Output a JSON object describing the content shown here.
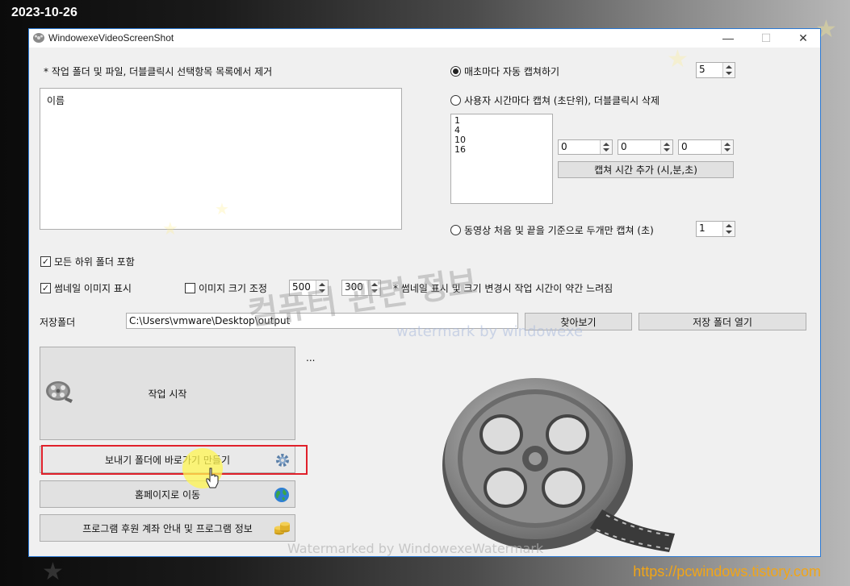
{
  "page": {
    "date": "2023-10-26",
    "site": "https://pcwindows.tistory.com"
  },
  "window": {
    "title": "WindowexeVideoScreenShot",
    "controls": [
      "—",
      "☐",
      "✕"
    ]
  },
  "left": {
    "folder_hint": "* 작업 폴더 및 파일, 더블클릭시 선택항목 목록에서 제거",
    "list_header": "이름",
    "include_subfolders": "모든 하위 폴더 포함",
    "show_thumbs": "썸네일 이미지 표시",
    "resize_images": "이미지 크기 조정",
    "width": "500",
    "height": "300",
    "thumb_note": "* 썸네일 표시 및 크기 변경시 작업 시간이 약간 느려짐",
    "save_label": "저장폴더",
    "save_path": "C:\\Users\\vmware\\Desktop\\output",
    "browse": "찾아보기",
    "open_folder": "저장 폴더 열기",
    "start": "작업 시작",
    "status_dots": "...",
    "sendto": "보내기 폴더에 바로가기 만들기",
    "homepage": "홈페이지로 이동",
    "about": "프로그램 후원 계좌 안내 및 프로그램 정보"
  },
  "right": {
    "opt_every_sec": "매초마다 자동 캡쳐하기",
    "every_sec_val": "5",
    "opt_user_times": "사용자 시간마다 캡쳐 (초단위), 더블클릭시 삭제",
    "times": [
      "1",
      "4",
      "10",
      "16"
    ],
    "hour": "0",
    "minute": "0",
    "second": "0",
    "add_time": "캡쳐 시간 추가 (시,분,초)",
    "opt_start_end": "동영상 처음 및 끝을 기준으로 두개만 캡쳐 (초)",
    "start_end_val": "1"
  },
  "watermarks": {
    "center": "컴퓨터 관련 정보",
    "blue": "watermark by windowexe",
    "bottom": "Watermarked by WindowexeWatermark"
  },
  "colors": {
    "accent": "#2b79d4",
    "highlight": "#e0202a",
    "site": "#f2a516"
  }
}
